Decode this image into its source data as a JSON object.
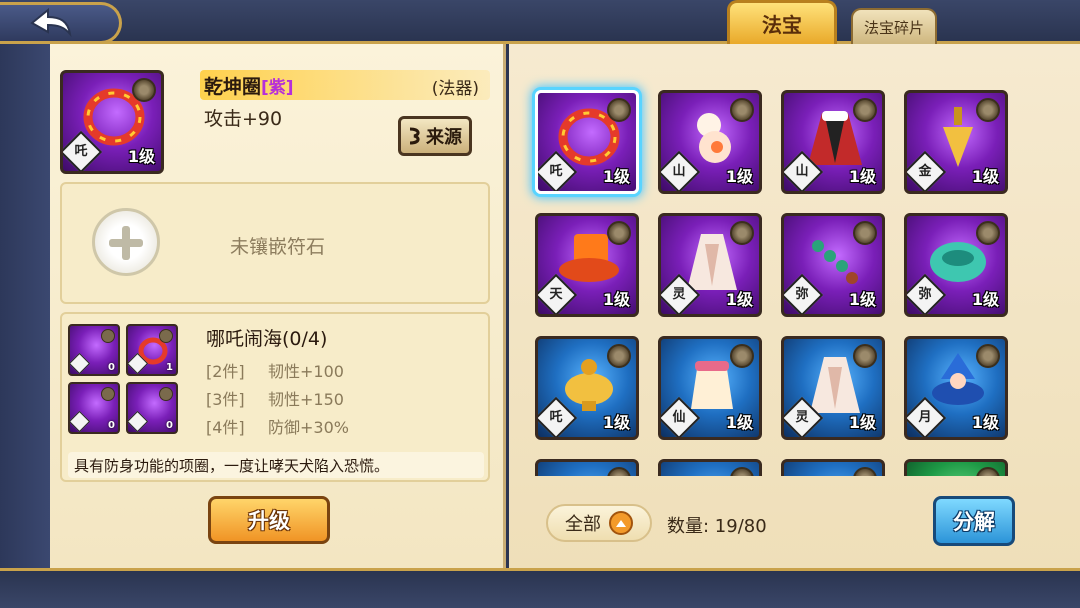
{
  "tabs": [
    {
      "label": "法宝",
      "active": true
    },
    {
      "label": "法宝碎片",
      "active": false
    }
  ],
  "detail": {
    "name": "乾坤圈",
    "quality": "[紫]",
    "type": "(法器)",
    "attack": "攻击+90",
    "source_label": "来源",
    "card": {
      "badge": "吒",
      "level": "1级",
      "rarity": "purple"
    },
    "rune_empty_text": "未镶嵌符石"
  },
  "set": {
    "title": "哪吒闹海(0/4)",
    "items": [
      {
        "count": "0",
        "rarity": "purple"
      },
      {
        "count": "1",
        "rarity": "purple"
      },
      {
        "count": "0",
        "rarity": "purple"
      },
      {
        "count": "0",
        "rarity": "purple"
      }
    ],
    "bonuses": [
      {
        "req": "[2件]",
        "effect": "韧性+100"
      },
      {
        "req": "[3件]",
        "effect": "韧性+150"
      },
      {
        "req": "[4件]",
        "effect": "防御+30%"
      }
    ],
    "description": "具有防身功能的项圈，一度让哮天犬陷入恐慌。"
  },
  "upgrade_label": "升级",
  "inventory": {
    "items": [
      {
        "badge": "吒",
        "level": "1级",
        "rarity": "purple",
        "icon": "ring-icon",
        "selected": true
      },
      {
        "badge": "山",
        "level": "1级",
        "rarity": "purple",
        "icon": "gourd-icon",
        "selected": false
      },
      {
        "badge": "山",
        "level": "1级",
        "rarity": "purple",
        "icon": "cloak-icon",
        "selected": false
      },
      {
        "badge": "金",
        "level": "1级",
        "rarity": "purple",
        "icon": "pestle-icon",
        "selected": false
      },
      {
        "badge": "天",
        "level": "1级",
        "rarity": "purple",
        "icon": "hat-icon",
        "selected": false
      },
      {
        "badge": "灵",
        "level": "1级",
        "rarity": "purple",
        "icon": "robe-icon",
        "selected": false
      },
      {
        "badge": "弥",
        "level": "1级",
        "rarity": "purple",
        "icon": "beads-icon",
        "selected": false
      },
      {
        "badge": "弥",
        "level": "1级",
        "rarity": "purple",
        "icon": "bowl-icon",
        "selected": false
      },
      {
        "badge": "吒",
        "level": "1级",
        "rarity": "blue",
        "icon": "golden-lamp-icon",
        "selected": false
      },
      {
        "badge": "仙",
        "level": "1级",
        "rarity": "blue",
        "icon": "pouch-icon",
        "selected": false
      },
      {
        "badge": "灵",
        "level": "1级",
        "rarity": "blue",
        "icon": "robe-icon",
        "selected": false
      },
      {
        "badge": "月",
        "level": "1级",
        "rarity": "blue",
        "icon": "wizard-icon",
        "selected": false
      },
      {
        "badge": "",
        "level": "",
        "rarity": "blue",
        "icon": "",
        "selected": false
      },
      {
        "badge": "",
        "level": "",
        "rarity": "blue",
        "icon": "",
        "selected": false
      },
      {
        "badge": "",
        "level": "",
        "rarity": "blue",
        "icon": "",
        "selected": false
      },
      {
        "badge": "",
        "level": "",
        "rarity": "green",
        "icon": "",
        "selected": false
      }
    ],
    "filter_label": "全部",
    "count_text": "数量: 19/80",
    "decompose_label": "分解"
  }
}
